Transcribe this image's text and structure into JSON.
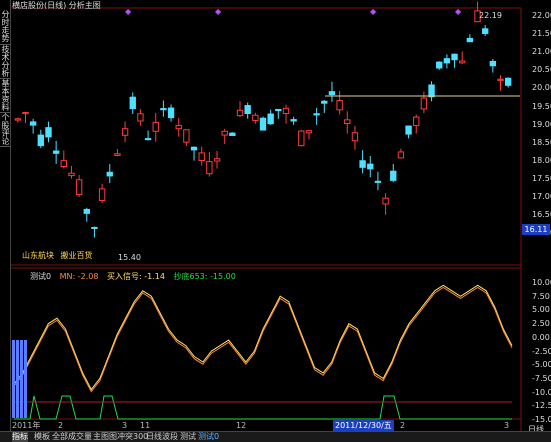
{
  "window": {
    "title": "横店股份(日线) 分析主图"
  },
  "sidebar": {
    "tabs": [
      {
        "label": "分时走势"
      },
      {
        "label": "技术分析"
      },
      {
        "label": "基本资料"
      },
      {
        "label": "个股评论"
      }
    ]
  },
  "price_axis": {
    "labels": [
      "22.00",
      "21.50",
      "21.00",
      "20.50",
      "20.00",
      "19.50",
      "19.00",
      "18.50",
      "18.00",
      "17.50",
      "17.00",
      "16.50",
      "16.00"
    ],
    "current_price": "16.11"
  },
  "annotations": {
    "high_label": "22.19",
    "low_label": "15.40",
    "stock_label": "山东航块",
    "sector_label": "搬业百货"
  },
  "indicator": {
    "name": "测试0",
    "mn": "MN: -2.08",
    "buy_signal": "买入信号: -1.14",
    "bottom": "抄底653: -15.00",
    "axis_labels": [
      "10.00",
      "7.50",
      "5.00",
      "2.50",
      "0.00",
      "-2.50",
      "-5.00",
      "-7.50",
      "-10.00",
      "-12.50",
      "-15.00"
    ]
  },
  "date_axis": {
    "labels": [
      "2011年",
      "2",
      "3",
      "11",
      "12",
      "2",
      "3"
    ],
    "highlight": "2011/12/30/五"
  },
  "bottom_tabs": [
    "指标",
    "模板",
    "全部",
    "成交量",
    "主图图",
    "冲突300",
    "日线波段",
    "测试",
    "测试0"
  ],
  "period_label": "日线",
  "colors": {
    "up": "#ff3b3b",
    "down": "#4fe0ff",
    "mn_line": "#ff8a3d",
    "buy_line": "#ffe066",
    "bottom_line": "#22dd44",
    "support": "#e8d28a",
    "accent": "#1a3fbf"
  }
}
